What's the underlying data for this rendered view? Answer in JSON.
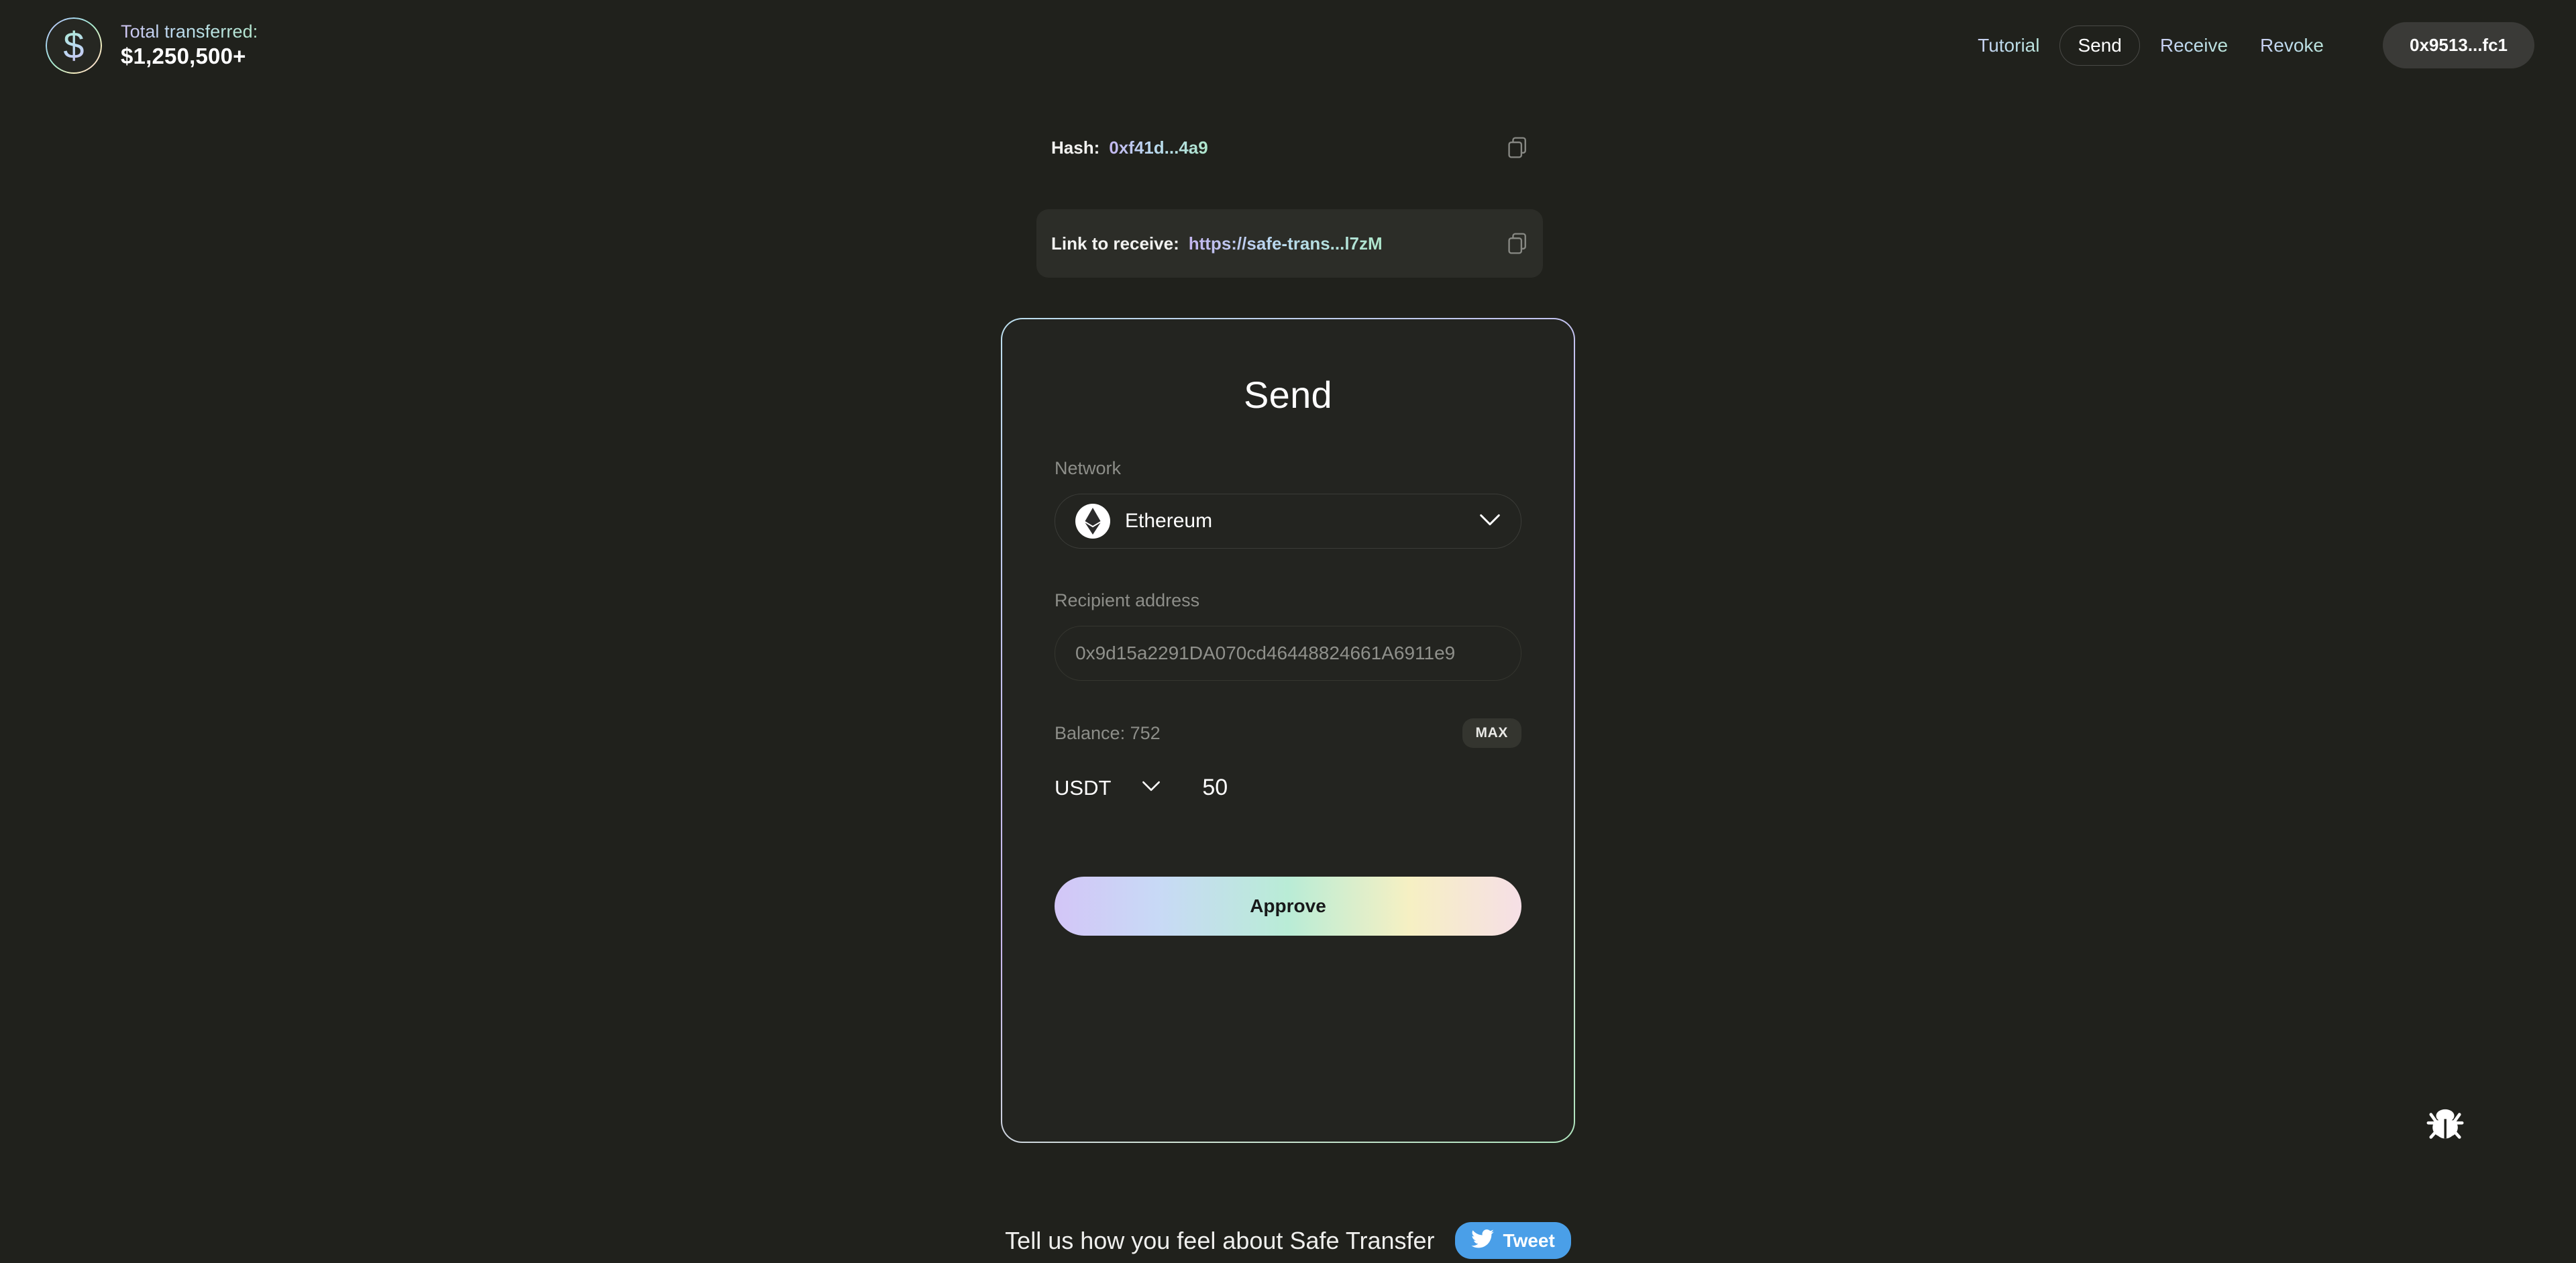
{
  "header": {
    "logo_icon": "dollar-coin-icon",
    "total_label": "Total transferred:",
    "total_amount": "$1,250,500+",
    "nav": [
      {
        "label": "Tutorial",
        "active": false
      },
      {
        "label": "Send",
        "active": true
      },
      {
        "label": "Receive",
        "active": false
      },
      {
        "label": "Revoke",
        "active": false
      }
    ],
    "wallet": "0x9513...fc1"
  },
  "info": {
    "hash_key": "Hash:",
    "hash_value": "0xf41d...4a9",
    "link_key": "Link to receive:",
    "link_value": "https://safe-trans...l7zM",
    "copy_icon": "copy-icon"
  },
  "card": {
    "title": "Send",
    "network_label": "Network",
    "network_value": "Ethereum",
    "network_icon": "ethereum-icon",
    "recipient_label": "Recipient address",
    "recipient_placeholder": "0x9d15a2291DA070cd46448824661A6911e9",
    "recipient_value": "",
    "balance_text": "Balance: 752",
    "max_label": "MAX",
    "token": "USDT",
    "amount": "50",
    "approve_label": "Approve"
  },
  "bug": {
    "icon": "bug-icon"
  },
  "footer": {
    "text": "Tell us how you feel about Safe Transfer",
    "tweet_label": "Tweet",
    "tweet_icon": "twitter-bird-icon"
  },
  "colors": {
    "background": "#20211c",
    "card_background": "#232420",
    "accent_gradient_start": "#d3c6f7",
    "accent_gradient_end": "#f6dfe6",
    "twitter_blue": "#4a9fe8"
  }
}
